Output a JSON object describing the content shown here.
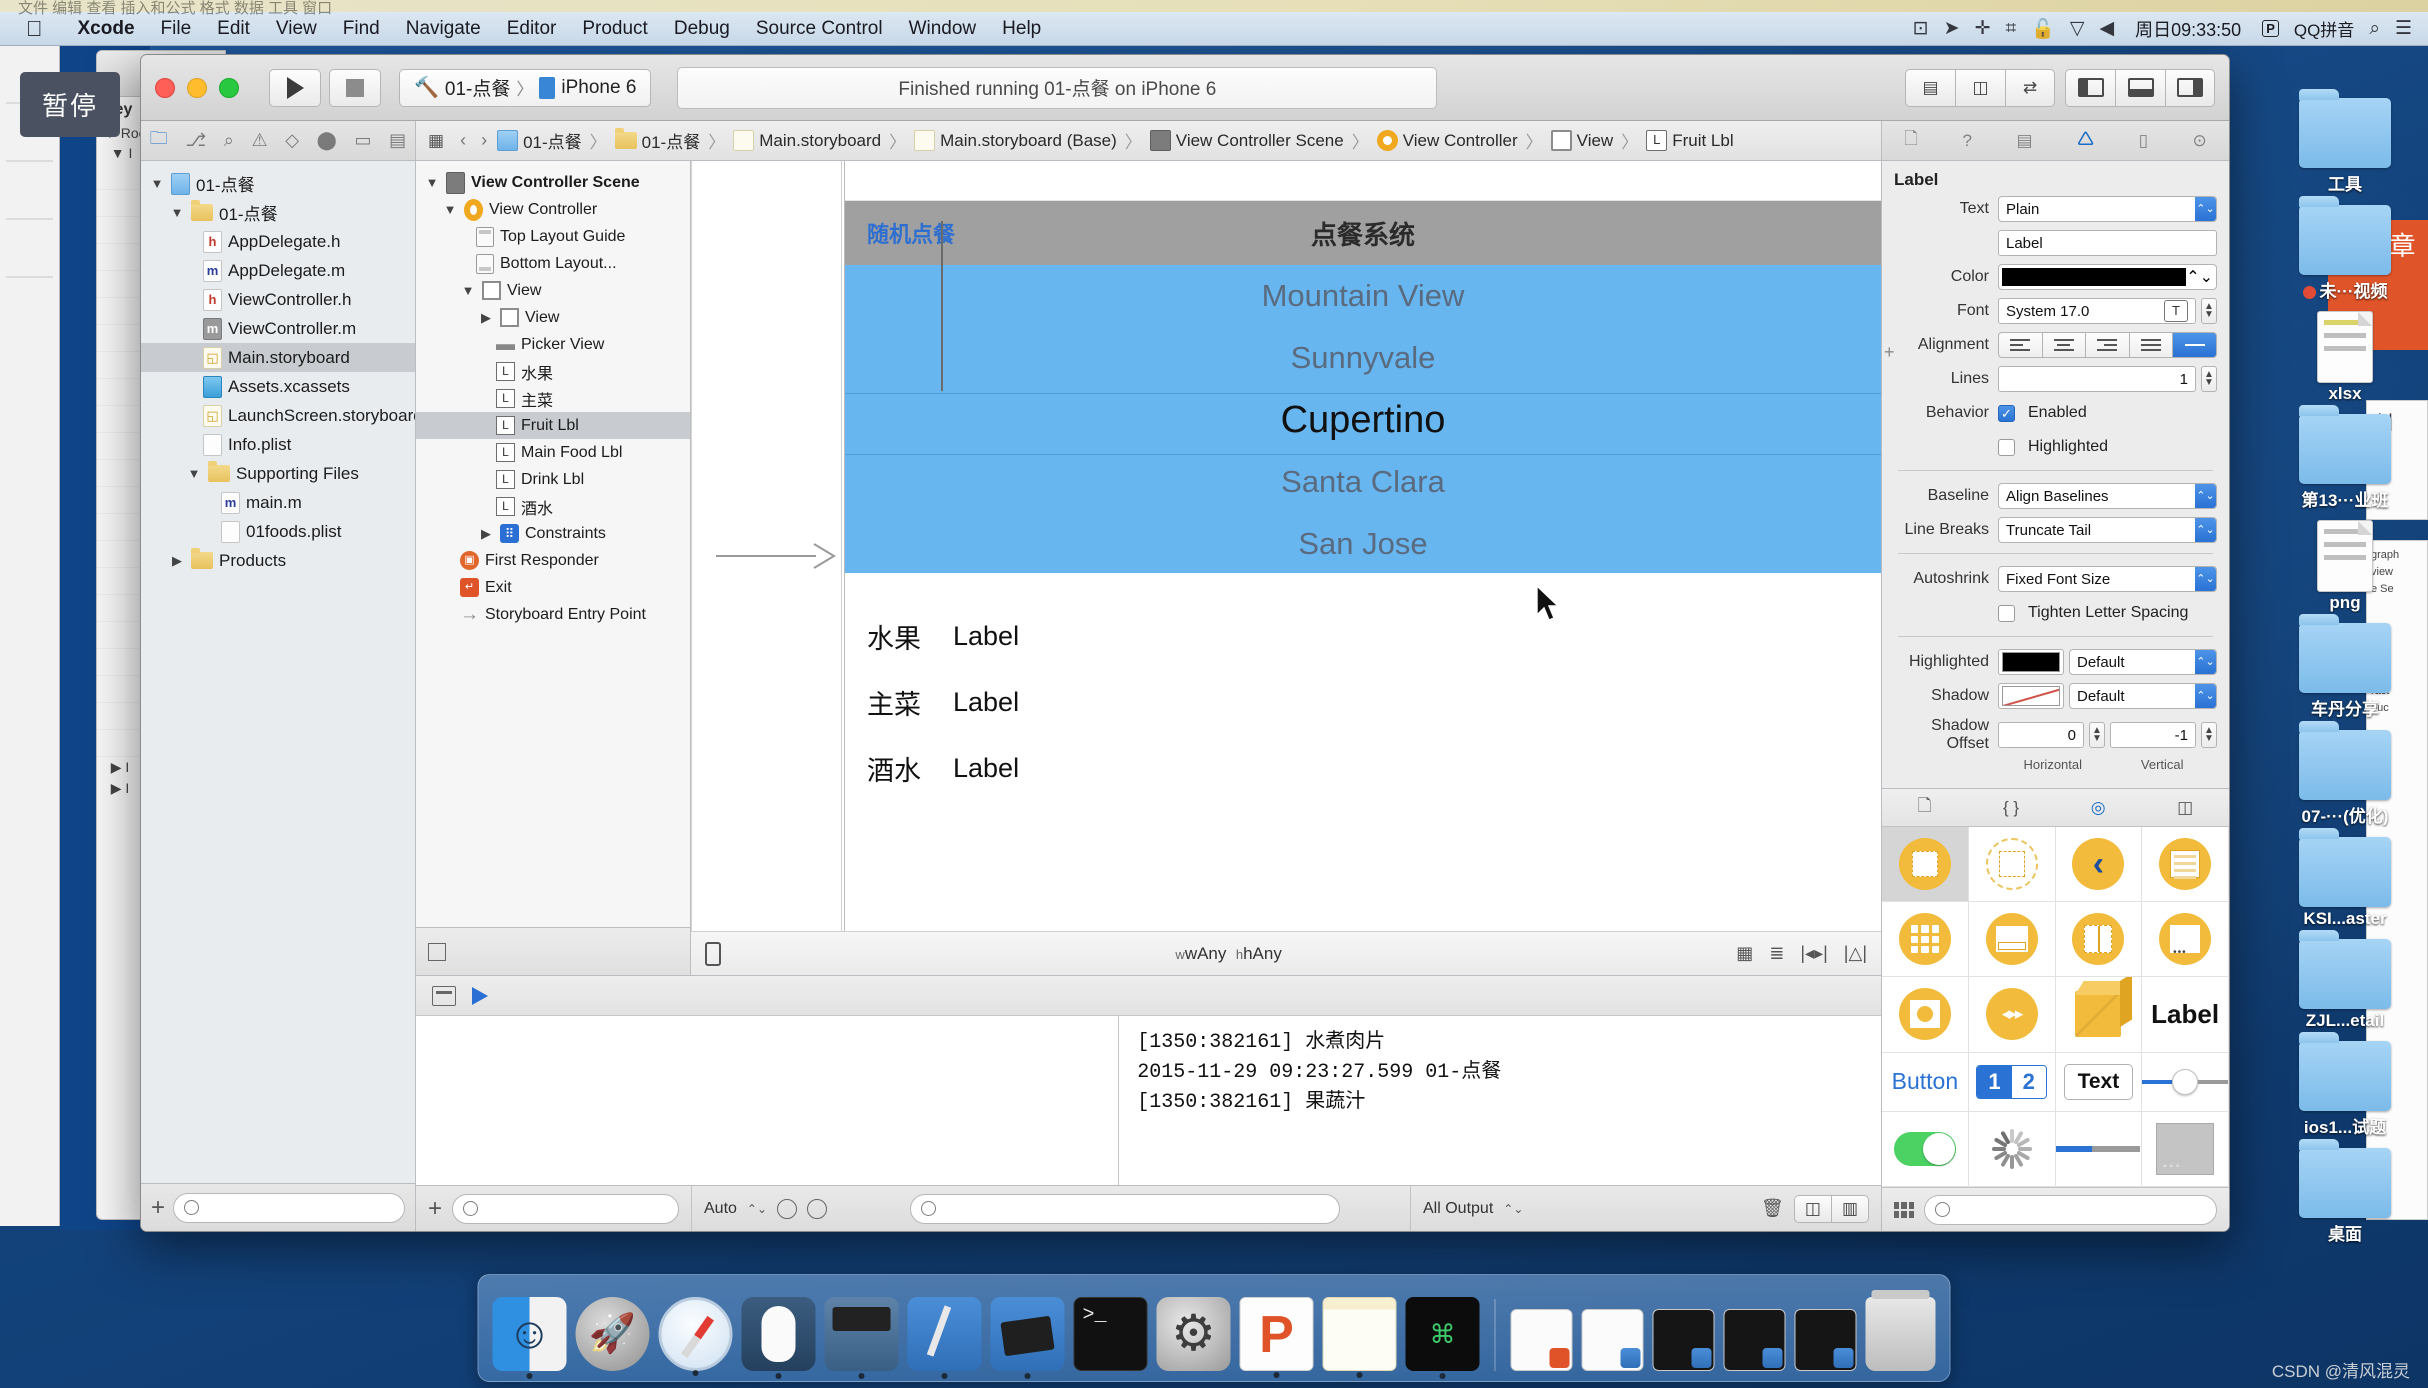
{
  "menubar": {
    "apple": "apple-logo",
    "items": [
      "Xcode",
      "File",
      "Edit",
      "View",
      "Find",
      "Navigate",
      "Editor",
      "Product",
      "Debug",
      "Source Control",
      "Window",
      "Help"
    ],
    "status_icons": [
      "screen-record-icon",
      "airplay-icon",
      "bluetooth-icon",
      "bluetooth-device-icon",
      "lock-icon",
      "wifi-icon",
      "volume-icon"
    ],
    "clock": "周日09:33:50",
    "input_badge": "P",
    "input_method": "QQ拼音",
    "search_icon": "search-icon",
    "notification_icon": "notification-center-icon"
  },
  "top_sliver_text": "文件   编辑   查看   插入和公式   格式   数据   工具   窗口",
  "pause_chip": "暂停",
  "window": {
    "toolbar": {
      "run_label": "run",
      "stop_label": "stop",
      "scheme_project": "01-点餐",
      "scheme_sep": "〉",
      "scheme_device": "iPhone 6",
      "status": "Finished running 01-点餐 on iPhone 6",
      "editor_segments": [
        "standard-editor",
        "assistant-editor",
        "version-editor"
      ],
      "view_segments": [
        "toggle-navigator",
        "toggle-debug-area",
        "toggle-utilities"
      ]
    },
    "navigator": {
      "tabs": [
        "folder-icon",
        "source-control-icon",
        "search-icon",
        "issue-icon",
        "test-icon",
        "debug-icon",
        "breakpoint-icon",
        "report-icon"
      ],
      "tree": [
        {
          "label": "01-点餐",
          "depth": 0,
          "twisty": "▼",
          "icon": "project-icon",
          "selected": false
        },
        {
          "label": "01-点餐",
          "depth": 1,
          "twisty": "▼",
          "icon": "folder-icon",
          "selected": false
        },
        {
          "label": "AppDelegate.h",
          "depth": 2,
          "twisty": "",
          "icon": "header-file-icon",
          "selected": false
        },
        {
          "label": "AppDelegate.m",
          "depth": 2,
          "twisty": "",
          "icon": "source-file-icon",
          "selected": false
        },
        {
          "label": "ViewController.h",
          "depth": 2,
          "twisty": "",
          "icon": "header-file-icon",
          "selected": false
        },
        {
          "label": "ViewController.m",
          "depth": 2,
          "twisty": "",
          "icon": "source-file-icon",
          "selected": false
        },
        {
          "label": "Main.storyboard",
          "depth": 2,
          "twisty": "",
          "icon": "storyboard-icon",
          "selected": true
        },
        {
          "label": "Assets.xcassets",
          "depth": 2,
          "twisty": "",
          "icon": "assets-icon",
          "selected": false
        },
        {
          "label": "LaunchScreen.storyboard",
          "depth": 2,
          "twisty": "",
          "icon": "storyboard-icon",
          "selected": false
        },
        {
          "label": "Info.plist",
          "depth": 2,
          "twisty": "",
          "icon": "plist-icon",
          "selected": false
        },
        {
          "label": "Supporting Files",
          "depth": 1,
          "twisty": "▼",
          "icon": "folder-icon",
          "selected": false
        },
        {
          "label": "main.m",
          "depth": 2,
          "twisty": "",
          "icon": "source-file-icon",
          "selected": false
        },
        {
          "label": "01foods.plist",
          "depth": 2,
          "twisty": "",
          "icon": "plist-icon",
          "selected": false
        },
        {
          "label": "Products",
          "depth": 0,
          "twisty": "▶",
          "icon": "folder-icon",
          "selected": false
        }
      ],
      "filter_placeholder": ""
    },
    "jumpbar": [
      {
        "label": "01-点餐",
        "icon": "project-icon"
      },
      {
        "label": "01-点餐",
        "icon": "folder-icon"
      },
      {
        "label": "Main.storyboard",
        "icon": "storyboard-icon"
      },
      {
        "label": "Main.storyboard (Base)",
        "icon": "storyboard-icon"
      },
      {
        "label": "View Controller Scene",
        "icon": "scene-icon"
      },
      {
        "label": "View Controller",
        "icon": "view-controller-icon"
      },
      {
        "label": "View",
        "icon": "view-icon"
      },
      {
        "label": "Fruit Lbl",
        "icon": "label-icon"
      }
    ],
    "outline": [
      {
        "label": "View Controller Scene",
        "depth": 0,
        "twisty": "▼",
        "icon": "scene-icon",
        "selected": false,
        "bold": true
      },
      {
        "label": "View Controller",
        "depth": 1,
        "twisty": "▼",
        "icon": "view-controller-icon",
        "selected": false
      },
      {
        "label": "Top Layout Guide",
        "depth": 2,
        "twisty": "",
        "icon": "top-layout-guide-icon",
        "selected": false
      },
      {
        "label": "Bottom Layout...",
        "depth": 2,
        "twisty": "",
        "icon": "bottom-layout-guide-icon",
        "selected": false
      },
      {
        "label": "View",
        "depth": 2,
        "twisty": "▼",
        "icon": "view-icon",
        "selected": false
      },
      {
        "label": "View",
        "depth": 3,
        "twisty": "▶",
        "icon": "view-icon",
        "selected": false
      },
      {
        "label": "Picker View",
        "depth": 3,
        "twisty": "",
        "icon": "picker-view-icon",
        "selected": false
      },
      {
        "label": "水果",
        "depth": 3,
        "twisty": "",
        "icon": "label-icon",
        "selected": false
      },
      {
        "label": "主菜",
        "depth": 3,
        "twisty": "",
        "icon": "label-icon",
        "selected": false
      },
      {
        "label": "Fruit Lbl",
        "depth": 3,
        "twisty": "",
        "icon": "label-icon",
        "selected": true
      },
      {
        "label": "Main Food Lbl",
        "depth": 3,
        "twisty": "",
        "icon": "label-icon",
        "selected": false
      },
      {
        "label": "Drink Lbl",
        "depth": 3,
        "twisty": "",
        "icon": "label-icon",
        "selected": false
      },
      {
        "label": "酒水",
        "depth": 3,
        "twisty": "",
        "icon": "label-icon",
        "selected": false
      },
      {
        "label": "Constraints",
        "depth": 3,
        "twisty": "▶",
        "icon": "constraints-icon",
        "selected": false
      },
      {
        "label": "First Responder",
        "depth": 1,
        "twisty": "",
        "icon": "first-responder-icon",
        "selected": false
      },
      {
        "label": "Exit",
        "depth": 1,
        "twisty": "",
        "icon": "exit-icon",
        "selected": false
      },
      {
        "label": "Storyboard Entry Point",
        "depth": 1,
        "twisty": "",
        "icon": "entry-point-icon",
        "selected": false
      }
    ],
    "canvas": {
      "navbar_left_button": "随机点餐",
      "navbar_title": "点餐系统",
      "picker_rows": [
        "Mountain View",
        "Sunnyvale",
        "Cupertino",
        "Santa Clara",
        "San Jose"
      ],
      "picker_selected_index": 2,
      "label_rows": [
        {
          "key": "水果",
          "value": "Label",
          "selected": true
        },
        {
          "key": "主菜",
          "value": "Label",
          "selected": false
        },
        {
          "key": "酒水",
          "value": "Label",
          "selected": false
        }
      ],
      "size_class_w": "wAny",
      "size_class_h": "hAny",
      "align_tools": [
        "align-icon",
        "pin-icon",
        "resolve-issues-icon",
        "resizing-icon"
      ]
    },
    "debug": {
      "console_lines": [
        "[1350:382161] 水煮肉片",
        "2015-11-29 09:23:27.599 01-点餐",
        "[1350:382161] 果蔬汁"
      ],
      "scope_label": "Auto",
      "output_filter": "All Output",
      "console_filter_placeholder": ""
    },
    "inspector": {
      "tabs": [
        "file-inspector-icon",
        "quick-help-icon",
        "identity-inspector-icon",
        "attributes-inspector-icon",
        "size-inspector-icon",
        "connections-inspector-icon"
      ],
      "active_tab_index": 3,
      "section_title": "Label",
      "fields": {
        "text_label": "Text",
        "text_value": "Plain",
        "text_content": "Label",
        "color_label": "Color",
        "color_value": "#000000",
        "font_label": "Font",
        "font_value": "System 17.0",
        "alignment_label": "Alignment",
        "alignment_selected_index": 4,
        "lines_label": "Lines",
        "lines_value": "1",
        "behavior_label": "Behavior",
        "enabled_label": "Enabled",
        "enabled_checked": true,
        "highlighted_label": "Highlighted",
        "highlighted_checked": false,
        "baseline_label": "Baseline",
        "baseline_value": "Align Baselines",
        "line_breaks_label": "Line Breaks",
        "line_breaks_value": "Truncate Tail",
        "autoshrink_label": "Autoshrink",
        "autoshrink_value": "Fixed Font Size",
        "tighten_label": "Tighten Letter Spacing",
        "tighten_checked": false,
        "highlighted_color_label": "Highlighted",
        "highlighted_color_value": "Default",
        "shadow_label": "Shadow",
        "shadow_value": "Default",
        "shadow_offset_label": "Shadow Offset",
        "shadow_offset_h": "0",
        "shadow_offset_v": "-1",
        "shadow_offset_h_caption": "Horizontal",
        "shadow_offset_v_caption": "Vertical"
      }
    },
    "library": {
      "tabs": [
        "file-template-library-icon",
        "code-snippet-library-icon",
        "object-library-icon",
        "media-library-icon"
      ],
      "active_tab_index": 2,
      "objects": [
        {
          "name": "view-object",
          "selected": true
        },
        {
          "name": "container-view-object",
          "selected": false
        },
        {
          "name": "navigation-bar-object",
          "selected": false
        },
        {
          "name": "table-view-object",
          "selected": false
        },
        {
          "name": "collection-view-object",
          "selected": false
        },
        {
          "name": "banner-view-object",
          "selected": false
        },
        {
          "name": "page-view-object",
          "selected": false
        },
        {
          "name": "scroll-view-object",
          "selected": false
        },
        {
          "name": "image-view-object",
          "selected": false
        },
        {
          "name": "player-view-object",
          "selected": false
        },
        {
          "name": "scene-kit-view-object",
          "selected": false
        },
        {
          "name": "label-object",
          "label": "Label",
          "selected": false
        },
        {
          "name": "button-object",
          "label": "Button",
          "selected": false
        },
        {
          "name": "segmented-control-object",
          "label_a": "1",
          "label_b": "2",
          "selected": false
        },
        {
          "name": "text-field-object",
          "label": "Text",
          "selected": false
        },
        {
          "name": "slider-object",
          "selected": false
        },
        {
          "name": "switch-object",
          "selected": false
        },
        {
          "name": "activity-indicator-object",
          "selected": false
        },
        {
          "name": "progress-view-object",
          "selected": false
        },
        {
          "name": "page-control-object",
          "selected": false
        }
      ],
      "filter_placeholder": ""
    }
  },
  "desktop_icons": [
    {
      "label": "工具",
      "type": "folder"
    },
    {
      "label": "未···视频",
      "type": "folder",
      "badge": "recording-dot"
    },
    {
      "label": "xlsx",
      "type": "file-xlsx"
    },
    {
      "label": "第13···业班",
      "type": "folder"
    },
    {
      "label": "png",
      "type": "file-png"
    },
    {
      "label": "车丹分享",
      "type": "folder"
    },
    {
      "label": "07-···(优化)",
      "type": "folder"
    },
    {
      "label": "KSI...aster",
      "type": "folder"
    },
    {
      "label": "ZJL...etail",
      "type": "folder"
    },
    {
      "label": "ios1...试题",
      "type": "folder"
    },
    {
      "label": "桌面",
      "type": "folder"
    }
  ],
  "orange_card_text": "章",
  "white_card_text": "创",
  "dock": {
    "items": [
      {
        "name": "finder-dock-icon",
        "running": true
      },
      {
        "name": "launchpad-dock-icon",
        "running": false
      },
      {
        "name": "safari-dock-icon",
        "running": true
      },
      {
        "name": "mouse-app-dock-icon",
        "running": true
      },
      {
        "name": "quicktime-dock-icon",
        "running": true
      },
      {
        "name": "xcode-dock-icon",
        "running": true
      },
      {
        "name": "xcode-beta-dock-icon",
        "running": true
      },
      {
        "name": "terminal-dock-icon",
        "running": false
      },
      {
        "name": "system-preferences-dock-icon",
        "running": false
      },
      {
        "name": "pdf-reader-dock-icon",
        "running": true
      },
      {
        "name": "notes-dock-icon",
        "running": true
      },
      {
        "name": "iterm-dock-icon",
        "running": true
      }
    ],
    "minimized": [
      {
        "name": "minimized-window-pdf"
      },
      {
        "name": "minimized-window-blank"
      },
      {
        "name": "minimized-window-dark-1"
      },
      {
        "name": "minimized-window-dark-2"
      },
      {
        "name": "minimized-window-dark-3"
      }
    ],
    "trash": "trash-dock-icon"
  },
  "watermark": "CSDN @清风混灵"
}
